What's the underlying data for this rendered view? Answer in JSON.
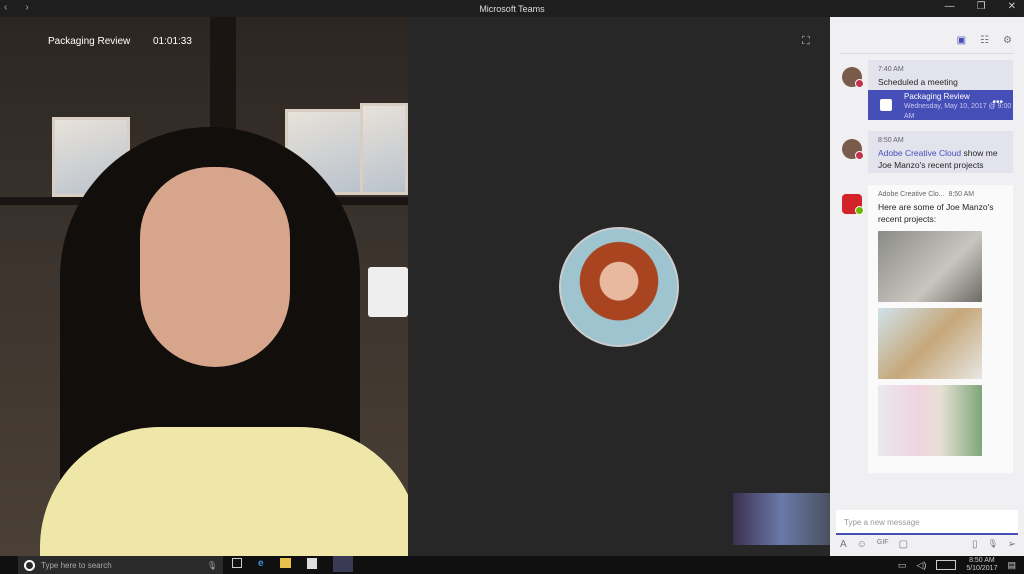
{
  "window": {
    "title": "Microsoft Teams",
    "back": "‹",
    "forward": "›",
    "minimize": "—",
    "restore": "❐",
    "close": "✕"
  },
  "call": {
    "meeting_name": "Packaging Review",
    "duration": "01:01:33",
    "expand_icon": "⛶"
  },
  "panel": {
    "tools": {
      "chat": "▣",
      "participants": "☷",
      "settings": "⚙"
    },
    "messages": [
      {
        "time": "7:40 AM",
        "text": "Scheduled a meeting",
        "card": {
          "title": "Packaging Review",
          "subtitle": "Wednesday, May 10, 2017 @ 9:00 AM",
          "more": "•••"
        }
      },
      {
        "time": "8:50 AM",
        "mention": "Adobe Creative Cloud",
        "text": " show me Joe Manzo's recent projects"
      },
      {
        "sender": "Adobe Creative Clo...",
        "time": "8:50 AM",
        "text": "Here are some of Joe Manzo's recent projects:"
      }
    ],
    "compose_placeholder": "Type a new message",
    "compose_tools": {
      "format": "A",
      "emoji": "☺",
      "gif": "GIF",
      "sticker": "▢",
      "attach": "▯",
      "audio": "🎙",
      "send": "➢"
    }
  },
  "taskbar": {
    "search_placeholder": "Type here to search",
    "mic": "🎙",
    "time": "8:50 AM",
    "date": "5/10/2017",
    "notifications": "▤"
  },
  "colors": {
    "accent": "#464eb8",
    "panel": "#f0f0f3"
  }
}
